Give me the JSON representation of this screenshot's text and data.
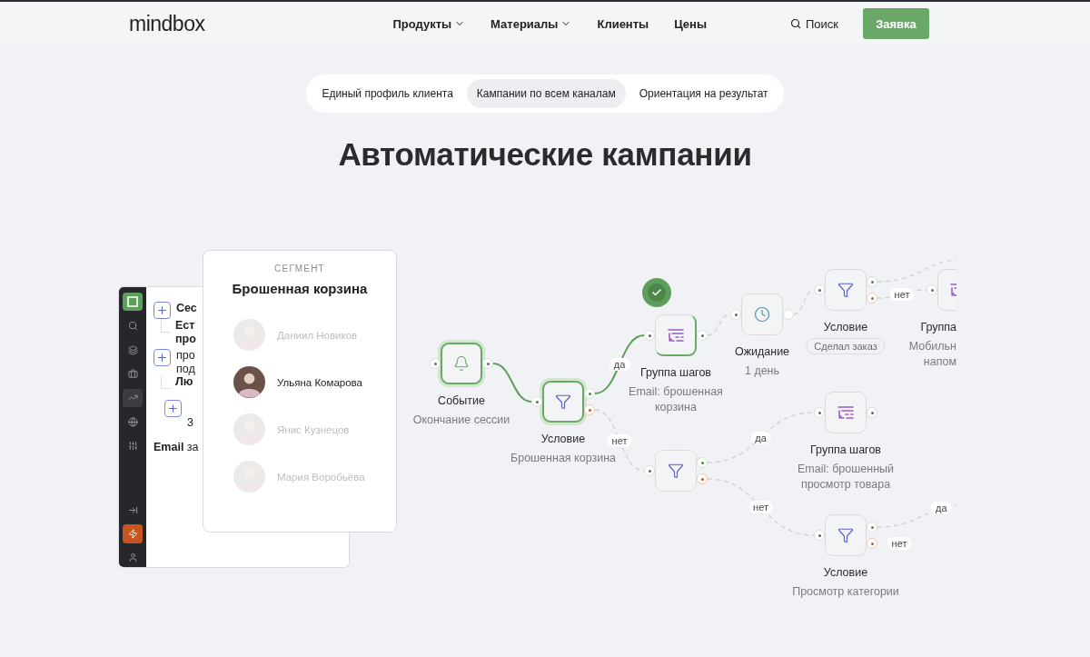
{
  "header": {
    "logo": "mindbox",
    "nav": [
      {
        "label": "Продукты",
        "dropdown": true
      },
      {
        "label": "Материалы",
        "dropdown": true
      },
      {
        "label": "Клиенты",
        "dropdown": false
      },
      {
        "label": "Цены",
        "dropdown": false
      }
    ],
    "search": "Поиск",
    "cta": "Заявка"
  },
  "tabs": [
    {
      "label": "Единый профиль клиента",
      "selected": false
    },
    {
      "label": "Кампании по всем каналам",
      "selected": true
    },
    {
      "label": "Ориентация на результат",
      "selected": false
    }
  ],
  "title": "Автоматические кампании",
  "app": {
    "sidebar": [
      {
        "selected": false,
        "accent": false
      },
      {
        "selected": false,
        "accent": false
      },
      {
        "selected": false,
        "accent": false
      },
      {
        "selected": true,
        "accent": false
      },
      {
        "selected": false,
        "accent": false
      },
      {
        "selected": false,
        "accent": false
      },
      {
        "selected": false,
        "accent": false
      },
      {
        "selected": false,
        "accent": true
      },
      {
        "selected": false,
        "accent": false
      }
    ],
    "rows": [
      {
        "kind": "add",
        "lines": [
          {
            "text": "Сес",
            "bold": true
          }
        ]
      },
      {
        "kind": "branch",
        "lines": [
          {
            "text": "Ест",
            "bold": true
          },
          {
            "text": "про",
            "bold": true
          }
        ]
      },
      {
        "kind": "add",
        "lines": [
          {
            "text": "про",
            "bold": false
          },
          {
            "text": "под",
            "bold": false
          }
        ]
      },
      {
        "kind": "branch",
        "lines": [
          {
            "text": "Лю",
            "bold": true
          }
        ]
      },
      {
        "kind": "nested_add",
        "lines": [
          {
            "text": "3",
            "bold": false
          }
        ]
      },
      {
        "kind": "text",
        "lines": [
          {
            "text": "**Email** за",
            "bold": false
          }
        ]
      }
    ]
  },
  "segment": {
    "label": "СЕГМЕНТ",
    "title": "Брошенная корзина",
    "people": [
      {
        "name": "Даниил Новиков",
        "selected": false
      },
      {
        "name": "Ульяна Комарова",
        "selected": true
      },
      {
        "name": "Янис Кузнецов",
        "selected": false
      },
      {
        "name": "Мария Воробьёва",
        "selected": false
      }
    ]
  },
  "flow": {
    "nodes": [
      {
        "kind": "event",
        "title": "Событие",
        "subtitle": "Окончание сессии",
        "active": true,
        "done": false
      },
      {
        "kind": "condition",
        "title": "Условие",
        "subtitle": "Брошенная корзина",
        "active": true,
        "done": false
      },
      {
        "kind": "group",
        "title": "Группа шагов",
        "subtitle": "Email: брошенная корзина",
        "active": false,
        "done": true
      },
      {
        "kind": "wait",
        "title": "Ожидание",
        "subtitle": "1 день",
        "active": false,
        "done": false
      },
      {
        "kind": "condition",
        "title": "Условие",
        "tag": "Сделал заказ",
        "active": false,
        "done": false
      },
      {
        "kind": "group",
        "title": "Группа",
        "subtitle": "Мобильн напом",
        "active": false,
        "done": false,
        "cut_off": true
      },
      {
        "kind": "condition",
        "active": false,
        "done": false
      },
      {
        "kind": "group",
        "title": "Группа шагов",
        "subtitle": "Email: брошенный просмотр товара",
        "active": false,
        "done": false
      },
      {
        "kind": "condition",
        "title": "Условие",
        "subtitle": "Просмотр категории",
        "active": false,
        "done": false
      }
    ],
    "edges": [
      {
        "active": true
      },
      {
        "active": true,
        "label": "да"
      },
      {
        "active": false,
        "label": "нет"
      },
      {
        "active": false
      },
      {
        "active": false
      },
      {
        "active": false,
        "label": "нет"
      },
      {
        "active": false
      },
      {
        "active": false,
        "label": "да"
      },
      {
        "active": false,
        "label": "нет"
      },
      {
        "active": false,
        "label": "да"
      },
      {
        "label": "нет"
      }
    ]
  }
}
